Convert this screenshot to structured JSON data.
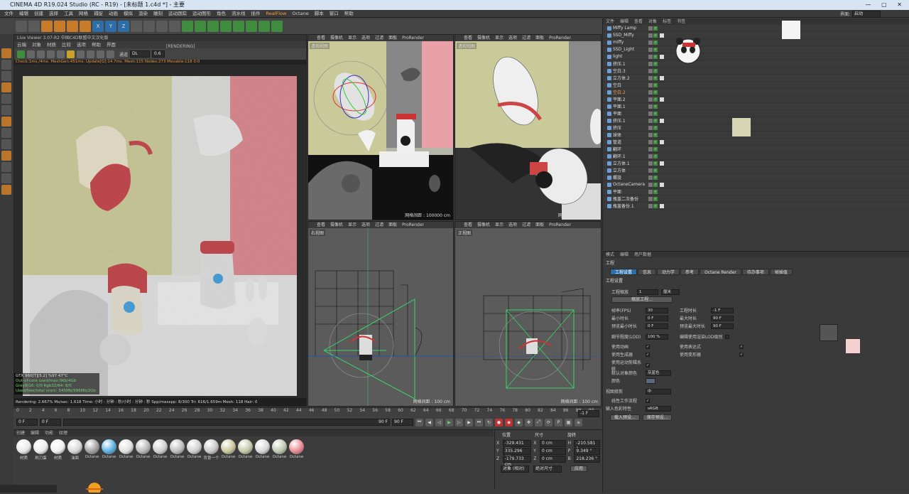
{
  "window": {
    "title": "CINEMA 4D R19.024 Studio (RC - R19) - [未标题 1.c4d *] - 主要",
    "controls": "— ▢ ✕"
  },
  "menu": [
    "文件",
    "编辑",
    "创建",
    "选择",
    "工具",
    "网格",
    "捕捉",
    "动画",
    "模拟",
    "渲染",
    "雕刻",
    "运动跟踪",
    "运动图形",
    "角色",
    "流水线",
    "插件",
    "RealFlow",
    "Octane",
    "脚本",
    "窗口",
    "帮助"
  ],
  "menu_right": {
    "label": "界面:",
    "value": "启动"
  },
  "toolbar_icons": [
    "undo-icon",
    "redo-icon",
    "select-icon",
    "move-icon",
    "scale-icon",
    "rotate-icon",
    "x-axis-icon",
    "y-axis-icon",
    "z-axis-icon",
    "coord-icon",
    "render-view-icon",
    "render-icon",
    "render-settings-icon",
    "cube-icon",
    "pen-icon",
    "subdivision-icon",
    "array-icon",
    "deformer-icon",
    "scene-icon",
    "camera-icon",
    "light-icon"
  ],
  "live_viewer": {
    "title": "Live Viewer 3.07-R2 中国C4D联盟中文汉化版",
    "menu": [
      "云端",
      "对象",
      "材质",
      "比较",
      "选项",
      "帮助",
      "界面"
    ],
    "rendering_label": "[RENDERING]",
    "channel_label": "通道",
    "channel_value": "DL",
    "value_field": "0.6",
    "status": "Check:1ms./4ms. MeshGen:451ms. Update[G]:14.7ms. Mesh:115 Nodes:273 Movable:118  0:0",
    "info": [
      "GTX 960[T][5.2]          %97     47°C",
      "Out-of-core used/max:0Kb/4Gb",
      "Grey8/16: 0/0        Rgb32/64: 8/0",
      "Used/free/total vram: 545Mb/996Mb/2Gb"
    ],
    "bottom": "Rendering: 2.667% Ms/sec: 1.618   Time: 小时 : 分钟 : 秒/小时 : 分钟 : 秒   Spp/maxspp: 8/300   Tri: 616/1.659m  Mesh: 118  Hair: 0"
  },
  "viewport_menu": [
    "查看",
    "摄像机",
    "显示",
    "选项",
    "过滤",
    "面板",
    "ProRender"
  ],
  "viewports": [
    {
      "name": "透视视图",
      "grid": "网格间距 : 100000 cm"
    },
    {
      "name": "透视视图",
      "grid": "网格间距 : 1000 cm"
    },
    {
      "name": "右视图",
      "grid": "网格间距 : 100 cm"
    },
    {
      "name": "正视图",
      "grid": "网格间距 : 100 cm"
    }
  ],
  "timeline": {
    "ticks": [
      "0",
      "2",
      "4",
      "6",
      "8",
      "10",
      "12",
      "14",
      "16",
      "18",
      "20",
      "22",
      "24",
      "26",
      "28",
      "30",
      "32",
      "34",
      "36",
      "38",
      "40",
      "42",
      "44",
      "46",
      "48",
      "50",
      "52",
      "54",
      "56",
      "58",
      "60",
      "62",
      "64",
      "66",
      "68",
      "70",
      "72",
      "74",
      "76",
      "78",
      "80",
      "82",
      "84",
      "86",
      "88",
      "90"
    ],
    "start": "0 F",
    "current": "0 F",
    "end": "90 F",
    "end2": "90 F",
    "frame_right": "-1 F"
  },
  "materials": {
    "menu": [
      "创建",
      "编辑",
      "功能",
      "纹理"
    ],
    "items": [
      {
        "label": "材质",
        "color": "#e8e8e8"
      },
      {
        "label": "刷刀蛋",
        "color": "#ececec"
      },
      {
        "label": "材质",
        "color": "#f0f0f0"
      },
      {
        "label": "油面",
        "color": "#d8d8d8"
      },
      {
        "label": "Octane",
        "color": "#a0a0a0"
      },
      {
        "label": "Octane",
        "color": "#58b0e0"
      },
      {
        "label": "Octane",
        "color": "#e0e0e0"
      },
      {
        "label": "Octane",
        "color": "#b8b8b8"
      },
      {
        "label": "Octane",
        "color": "#cfcfcf"
      },
      {
        "label": "Octane",
        "color": "#bdbdbd"
      },
      {
        "label": "Octane",
        "color": "#d0d0d0"
      },
      {
        "label": "背景一个",
        "color": "#c8c8c8"
      },
      {
        "label": "Octane",
        "color": "#c9c79a"
      },
      {
        "label": "Octane",
        "color": "#c2c8a8"
      },
      {
        "label": "Octane",
        "color": "#d8d8d8"
      },
      {
        "label": "Octane",
        "color": "#c0c8b0"
      },
      {
        "label": "Octane",
        "color": "#e88a92"
      }
    ]
  },
  "coords": {
    "headers": [
      "位置",
      "尺寸",
      "旋转"
    ],
    "rows": [
      {
        "axis": "X",
        "pos": "-329.431 cm",
        "size": "0 cm",
        "rot_axis": "H",
        "rot": "-210.581 °"
      },
      {
        "axis": "Y",
        "pos": "335.296 cm",
        "size": "0 cm",
        "rot_axis": "P",
        "rot": "9.349 °"
      },
      {
        "axis": "Z",
        "pos": "-179.733 cm",
        "size": "0 cm",
        "rot_axis": "B",
        "rot": "218.236 °"
      }
    ],
    "mode1": "对象 (相对)",
    "mode2": "绝对尺寸",
    "apply": "应用"
  },
  "object_manager": {
    "menu": [
      "文件",
      "编辑",
      "查看",
      "对象",
      "标签",
      "书签"
    ],
    "rows": [
      {
        "name": "Miffy Lamp",
        "sel": false
      },
      {
        "name": "SSD_Miffy",
        "sel": false
      },
      {
        "name": "miffy",
        "sel": false
      },
      {
        "name": "SSD_Light",
        "sel": false
      },
      {
        "name": "light",
        "sel": false
      },
      {
        "name": "挤压.1",
        "sel": false
      },
      {
        "name": "空白.3",
        "sel": false
      },
      {
        "name": "立方体.2",
        "sel": false
      },
      {
        "name": "空白",
        "sel": false
      },
      {
        "name": "空白.2",
        "sel": true
      },
      {
        "name": "平面.2",
        "sel": false
      },
      {
        "name": "平面.1",
        "sel": false
      },
      {
        "name": "平面",
        "sel": false
      },
      {
        "name": "挤压.1",
        "sel": false
      },
      {
        "name": "挤压",
        "sel": false
      },
      {
        "name": "球体",
        "sel": false
      },
      {
        "name": "管道",
        "sel": false
      },
      {
        "name": "翻环",
        "sel": false
      },
      {
        "name": "翻环.1",
        "sel": false
      },
      {
        "name": "立方体.1",
        "sel": false
      },
      {
        "name": "立方体",
        "sel": false
      },
      {
        "name": "螺旋",
        "sel": false
      },
      {
        "name": "OctaneCamera",
        "sel": false
      },
      {
        "name": "平面",
        "sel": false
      },
      {
        "name": "瓶盖二次备份",
        "sel": false
      },
      {
        "name": "瓶盖备份.1",
        "sel": false
      }
    ]
  },
  "attributes": {
    "menu": [
      "模式",
      "编辑",
      "用户数据"
    ],
    "section": "工程",
    "tabs": [
      "工程设置",
      "信息",
      "动力学",
      "参考",
      "Octane Render",
      "待办事项",
      "帧插值"
    ],
    "group": "工程设置",
    "scale_label": "工程缩放",
    "scale_value": "1",
    "scale_unit": "厘米",
    "scale_button": "缩放工程...",
    "fps_label": "帧率(FPS)",
    "fps_value": "30",
    "proj_time_label": "工程时长",
    "proj_time_value": "-1 F",
    "min_time_label": "最小时长",
    "min_time_value": "0 F",
    "max_time_label": "最大时长",
    "max_time_value": "90 F",
    "prev_min_label": "预览最小时长",
    "prev_min_value": "0 F",
    "prev_max_label": "预览最大时长",
    "prev_max_value": "90 F",
    "lod_label": "细节程度(LOD)",
    "lod_value": "100 %",
    "render_lod_label": "编辑使用渲染LOD级别",
    "anim_label": "使用动画",
    "expr_label": "使用表达式",
    "gen_label": "使用生成器",
    "deform_label": "使用变形器",
    "mograph_label": "使用运动剪辑系统",
    "obj_color_label": "默认对象颜色",
    "obj_color_value": "灰蓝色",
    "color_label": "颜色",
    "view_label": "视图修剪",
    "view_value": "中",
    "linear_label": "线性工作流程",
    "input_color_label": "输入色彩特性",
    "input_color_value": "sRGB",
    "load_btn": "载入预设...",
    "save_btn": "保存预设..."
  },
  "colors": {
    "accent": "#2d6ea8",
    "selection": "#ff9a3a",
    "background": "#3c3c3c"
  }
}
